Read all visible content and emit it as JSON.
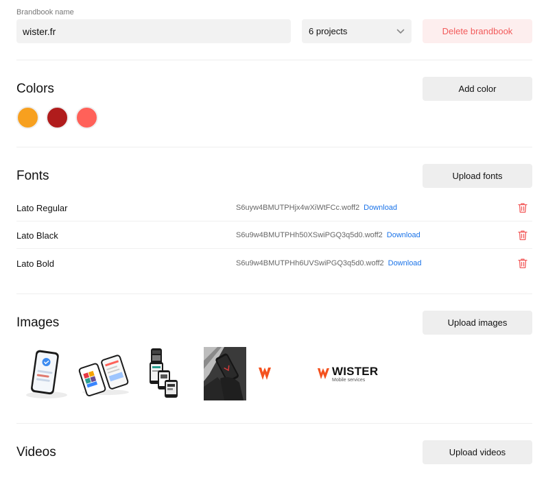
{
  "brandbook": {
    "name_label": "Brandbook name",
    "name_value": "wister.fr",
    "projects_value": "6 projects",
    "delete_label": "Delete brandbook"
  },
  "colors": {
    "title": "Colors",
    "add_label": "Add color",
    "swatches": [
      "#f7a01f",
      "#b01c1c",
      "#ff6159"
    ]
  },
  "fonts": {
    "title": "Fonts",
    "upload_label": "Upload fonts",
    "items": [
      {
        "name": "Lato Regular",
        "file": "S6uyw4BMUTPHjx4wXiWtFCc.woff2",
        "download": "Download"
      },
      {
        "name": "Lato Black",
        "file": "S6u9w4BMUTPHh50XSwiPGQ3q5d0.woff2",
        "download": "Download"
      },
      {
        "name": "Lato Bold",
        "file": "S6u9w4BMUTPHh6UVSwiPGQ3q5d0.woff2",
        "download": "Download"
      }
    ]
  },
  "images": {
    "title": "Images",
    "upload_label": "Upload images",
    "logo_text": "WISTER",
    "logo_sub": "Mobile services"
  },
  "videos": {
    "title": "Videos",
    "upload_label": "Upload videos"
  }
}
